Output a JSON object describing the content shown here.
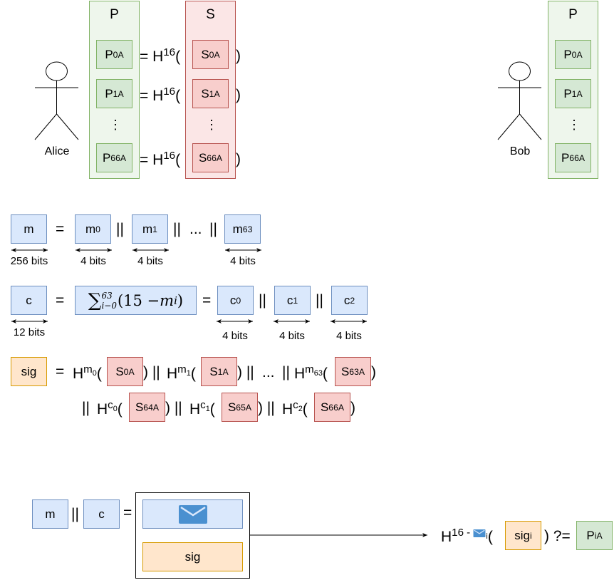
{
  "actors": {
    "alice": "Alice",
    "bob": "Bob"
  },
  "columns": {
    "public_header": "P",
    "secret_header": "S"
  },
  "keys": {
    "p0": {
      "base": "P",
      "sub": "0",
      "sup": "A"
    },
    "p1": {
      "base": "P",
      "sub": "1",
      "sup": "A"
    },
    "p66": {
      "base": "P",
      "sub": "66",
      "sup": "A"
    },
    "s0": {
      "base": "S",
      "sub": "0",
      "sup": "A"
    },
    "s1": {
      "base": "S",
      "sub": "1",
      "sup": "A"
    },
    "s66": {
      "base": "S",
      "sub": "66",
      "sup": "A"
    },
    "ellipsis": "⋮"
  },
  "hash_eq": {
    "prefix": "= H",
    "exp": "16",
    "open": "(",
    "close": ")"
  },
  "message_row": {
    "m": "m",
    "eq": "=",
    "m0": {
      "base": "m",
      "sub": "0"
    },
    "m1": {
      "base": "m",
      "sub": "1"
    },
    "m63": {
      "base": "m",
      "sub": "63"
    },
    "concat": "||",
    "dots": "...",
    "sizes": [
      "256 bits",
      "4 bits",
      "4 bits",
      "4 bits"
    ]
  },
  "checksum_row": {
    "c": "c",
    "eq": "=",
    "formula": {
      "sum": "∑",
      "upper": "63",
      "lower": "i−0",
      "body": "(15 − ",
      "var": "m",
      "var_sub": "i",
      "close": ")"
    },
    "c0": {
      "base": "c",
      "sub": "0"
    },
    "c1": {
      "base": "c",
      "sub": "1"
    },
    "c2": {
      "base": "c",
      "sub": "2"
    },
    "concat": "||",
    "sizes": [
      "12 bits",
      "4 bits",
      "4 bits",
      "4 bits"
    ]
  },
  "signature_row": {
    "sig": "sig",
    "eq": "=",
    "line1": [
      {
        "exp_base": "m",
        "exp_sub": "0",
        "key": {
          "base": "S",
          "sub": "0",
          "sup": "A"
        }
      },
      {
        "exp_base": "m",
        "exp_sub": "1",
        "key": {
          "base": "S",
          "sub": "1",
          "sup": "A"
        }
      },
      {
        "exp_base": "m",
        "exp_sub": "63",
        "key": {
          "base": "S",
          "sub": "63",
          "sup": "A"
        }
      }
    ],
    "line2": [
      {
        "exp_base": "c",
        "exp_sub": "0",
        "key": {
          "base": "S",
          "sub": "64",
          "sup": "A"
        }
      },
      {
        "exp_base": "c",
        "exp_sub": "1",
        "key": {
          "base": "S",
          "sub": "65",
          "sup": "A"
        }
      },
      {
        "exp_base": "c",
        "exp_sub": "2",
        "key": {
          "base": "S",
          "sub": "66",
          "sup": "A"
        }
      }
    ],
    "concat": "||",
    "dots": "..."
  },
  "transmit": {
    "m": "m",
    "concat": "||",
    "c": "c",
    "eq": "=",
    "envelope_icon": "envelope-icon",
    "sig": "sig"
  },
  "verify": {
    "h": "H",
    "exp": "16 -",
    "exp_sub": "i",
    "open": "(",
    "sig_base": "sig",
    "sig_sub": "i",
    "close": ")",
    "cmp": "?=",
    "p_base": "P",
    "p_sub": "i",
    "p_sup": "A"
  },
  "colors": {
    "green_fill": "#d5e8d4",
    "green_stroke": "#82b366",
    "red_fill": "#f8cecc",
    "red_stroke": "#b85450",
    "blue_fill": "#dae8fc",
    "blue_stroke": "#6c8ebf",
    "orange_fill": "#ffe6cc",
    "orange_stroke": "#d79b00",
    "envelope": "#4a90d0"
  }
}
